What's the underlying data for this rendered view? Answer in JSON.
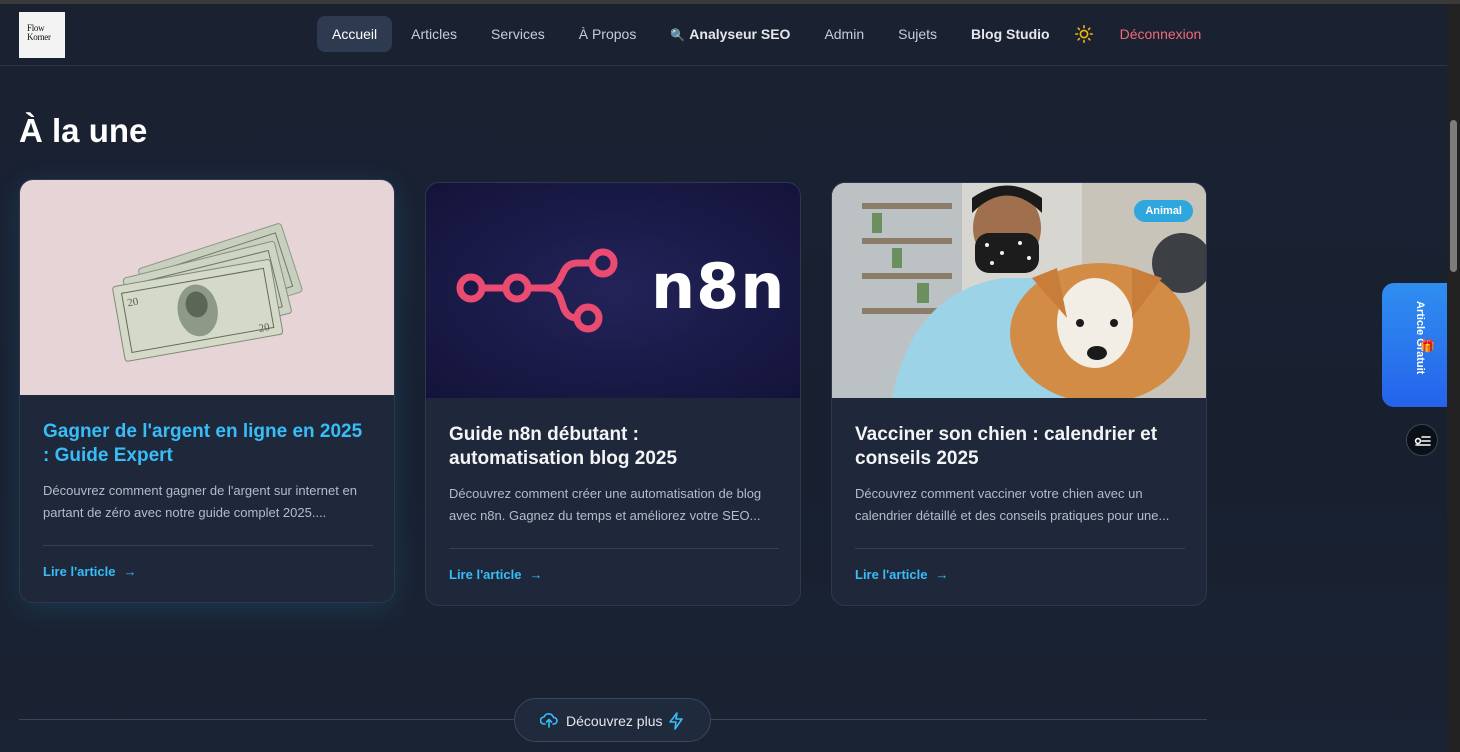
{
  "brand": {
    "logo_line1": "Flow",
    "logo_line2": "Korner"
  },
  "nav": {
    "items": [
      {
        "label": "Accueil",
        "active": true
      },
      {
        "label": "Articles"
      },
      {
        "label": "Services"
      },
      {
        "label": "À Propos"
      },
      {
        "label": "Analyseur SEO",
        "icon": "magnifier-icon"
      },
      {
        "label": "Admin"
      },
      {
        "label": "Sujets"
      },
      {
        "label": "Blog Studio"
      }
    ],
    "theme_icon": "sun-icon",
    "logout": "Déconnexion"
  },
  "section": {
    "title": "À la une"
  },
  "cards": [
    {
      "title": "Gagner de l'argent en ligne en 2025 : Guide Expert",
      "description": "Découvrez comment gagner de l'argent sur internet en partant de zéro avec notre guide complet 2025....",
      "link": "Lire l'article",
      "image": "dollar-bills-photo"
    },
    {
      "title": "Guide n8n débutant : automatisation blog 2025",
      "description": "Découvrez comment créer une automatisation de blog avec n8n. Gagnez du temps et améliorez votre SEO...",
      "link": "Lire l'article",
      "image_text": "n8n"
    },
    {
      "title": "Vacciner son chien : calendrier et conseils 2025",
      "description": "Découvrez comment vacciner votre chien avec un calendrier détaillé et des conseils pratiques pour une...",
      "link": "Lire l'article",
      "badge": "Animal",
      "image": "vet-with-puppy-photo"
    }
  ],
  "promo": {
    "label": "Article Gratuit",
    "icon": "gift-icon"
  },
  "floating": {
    "icon": "sliders-icon"
  },
  "discover": {
    "label": "Découvrez plus",
    "icon_left": "cloud-upload-icon",
    "icon_right": "lightning-icon"
  },
  "colors": {
    "accent": "#38bdf8",
    "logout": "#f06a7a",
    "badge": "#2ea6de",
    "promo": "#2f8ef0",
    "n8n_pink": "#ea4b71"
  }
}
